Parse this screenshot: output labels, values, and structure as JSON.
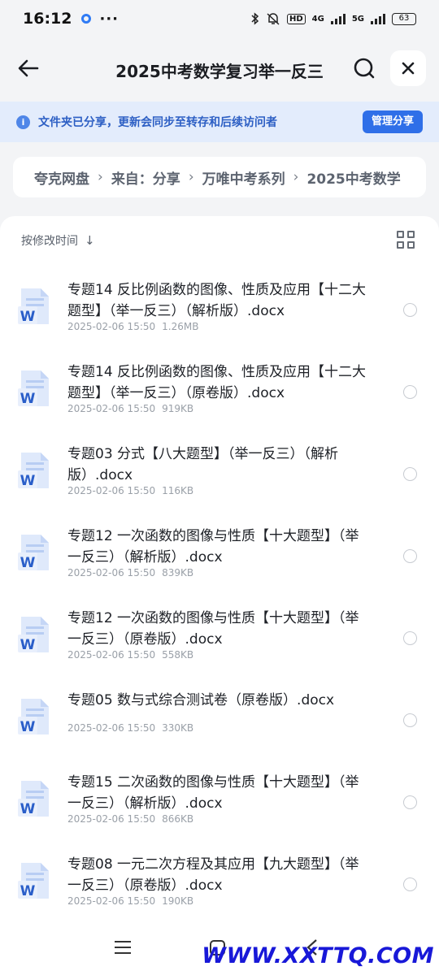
{
  "status_bar": {
    "time": "16:12",
    "more": "···",
    "hd": "HD",
    "net1": "4G",
    "net2": "5G",
    "battery": "63"
  },
  "header": {
    "title": "2025中考数学复习举一反三"
  },
  "share_banner": {
    "info_symbol": "i",
    "text": "文件夹已分享，更新会同步至转存和后续访问者",
    "manage_label": "管理分享"
  },
  "breadcrumb": {
    "items": [
      "夸克网盘",
      "来自：分享",
      "万唯中考系列",
      "2025中考数学"
    ],
    "separator": "›"
  },
  "sort": {
    "label": "按修改时间",
    "arrow": "↓"
  },
  "files": [
    {
      "name": "专题14 反比例函数的图像、性质及应用【十二大题型】（举一反三）（解析版）.docx",
      "date": "2025-02-06 15:50",
      "size": "1.26MB"
    },
    {
      "name": "专题14 反比例函数的图像、性质及应用【十二大题型】（举一反三）（原卷版）.docx",
      "date": "2025-02-06 15:50",
      "size": "919KB"
    },
    {
      "name": "专题03 分式【八大题型】（举一反三）（解析版）.docx",
      "date": "2025-02-06 15:50",
      "size": "116KB"
    },
    {
      "name": "专题12 一次函数的图像与性质【十大题型】（举一反三）（解析版）.docx",
      "date": "2025-02-06 15:50",
      "size": "839KB"
    },
    {
      "name": "专题12 一次函数的图像与性质【十大题型】（举一反三）（原卷版）.docx",
      "date": "2025-02-06 15:50",
      "size": "558KB"
    },
    {
      "name": "专题05 数与式综合测试卷（原卷版）.docx",
      "date": "2025-02-06 15:50",
      "size": "330KB"
    },
    {
      "name": "专题15 二次函数的图像与性质【十大题型】（举一反三）（解析版）.docx",
      "date": "2025-02-06 15:50",
      "size": "866KB"
    },
    {
      "name": "专题08 一元二次方程及其应用【九大题型】（举一反三）（原卷版）.docx",
      "date": "2025-02-06 15:50",
      "size": "190KB"
    }
  ],
  "file_icon_letter": "W",
  "watermark": "WWW.XXTTQ.COM",
  "colors": {
    "accent": "#2f6fe8",
    "banner_bg": "#e3ecfc",
    "word_blue": "#2a5ec9"
  }
}
